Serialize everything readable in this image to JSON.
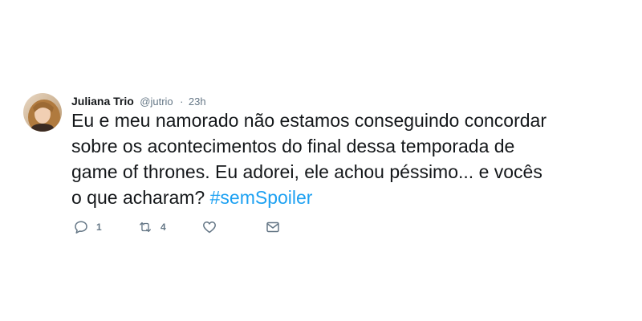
{
  "tweet": {
    "author": {
      "name": "Juliana Trio",
      "handle": "@jutrio"
    },
    "separator": "·",
    "time": "23h",
    "text_lines": [
      "Eu e meu namorado não estamos conseguindo concordar",
      "sobre os acontecimentos do final dessa temporada de",
      "game of thrones. Eu adorei, ele achou péssimo... e vocês",
      "o que acharam? "
    ],
    "hashtag": "#semSpoiler",
    "actions": {
      "reply_count": "1",
      "retweet_count": "4"
    },
    "icons": {
      "reply": "reply-icon",
      "retweet": "retweet-icon",
      "like": "heart-icon",
      "dm": "envelope-icon"
    },
    "colors": {
      "text": "#14171a",
      "secondary": "#657786",
      "accent": "#1da1f2",
      "icon": "#657786"
    }
  }
}
